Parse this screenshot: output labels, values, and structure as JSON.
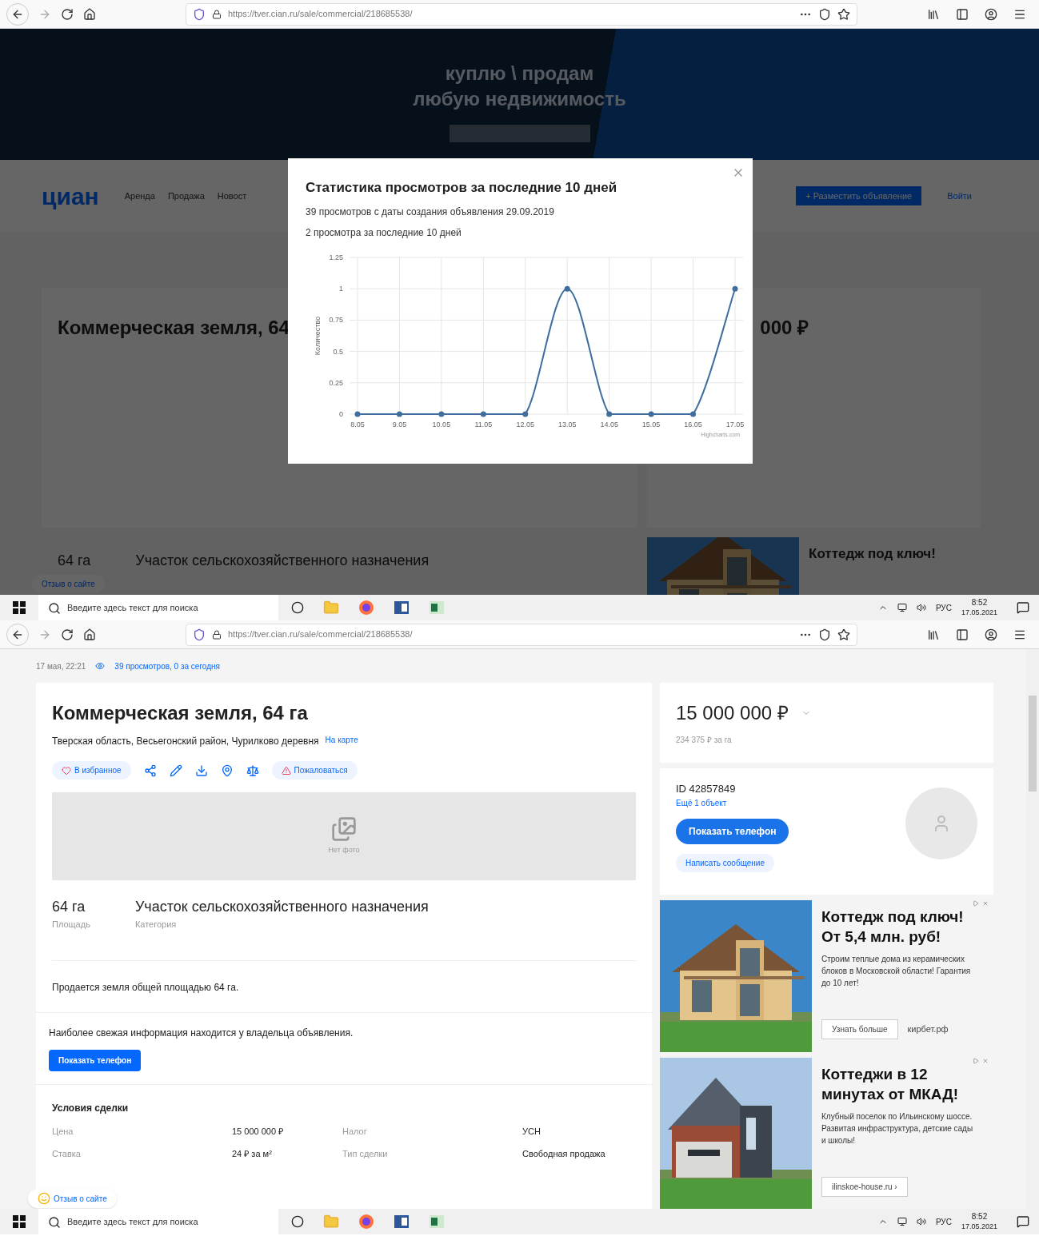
{
  "top_screen": {
    "browser": {
      "url": "https://tver.cian.ru/sale/commercial/218685538/"
    },
    "banner": {
      "headline": [
        "куплю \\ продам",
        "любую недвижимость"
      ]
    },
    "header": {
      "logo": "циан",
      "nav": [
        "Аренда",
        "Продажа",
        "Новост"
      ],
      "post_button": "+ Разместить объявление",
      "login": "Войти"
    },
    "listing": {
      "title": "Коммерческая земля, 64",
      "price": "000 ₽",
      "area": "64 га",
      "category": "Участок сельскохозяйственного назначения",
      "ad_title": "Коттедж под ключ!"
    },
    "feedback": "Отзыв о сайте",
    "modal": {
      "title": "Статистика просмотров за последние 10 дней",
      "lines": [
        "39 просмотров с даты создания объявления 29.09.2019",
        "2 просмотра за последние 10 дней"
      ],
      "chart_data": {
        "type": "line",
        "ylabel": "Количество",
        "categories": [
          "8.05",
          "9.05",
          "10.05",
          "11.05",
          "12.05",
          "13.05",
          "14.05",
          "15.05",
          "16.05",
          "17.05"
        ],
        "values": [
          0,
          0,
          0,
          0,
          0,
          1,
          0,
          0,
          0,
          1
        ],
        "ylim": [
          0,
          1.25
        ],
        "grid": true,
        "marker": true,
        "yticks": [
          0,
          0.25,
          0.5,
          0.75,
          1,
          1.25
        ]
      },
      "credit": "Highcharts.com"
    },
    "taskbar": {
      "search_placeholder": "Введите здесь текст для поиска",
      "language": "РУС",
      "time": "8:52",
      "date": "17.05.2021"
    }
  },
  "bottom_screen": {
    "browser": {
      "url": "https://tver.cian.ru/sale/commercial/218685538/"
    },
    "meta": {
      "date": "17 мая, 22:21",
      "views": "39 просмотров, 0 за сегодня"
    },
    "listing": {
      "title": "Коммерческая земля, 64 га",
      "address": "Тверская область, Весьегонский район, Чурилково деревня",
      "map_link": "На карте",
      "favorite": "В избранное",
      "report": "Пожаловаться",
      "no_photo": "Нет фото",
      "facts": [
        {
          "value": "64 га",
          "label": "Площадь"
        },
        {
          "value": "Участок сельскохозяйственного назначения",
          "label": "Категория"
        }
      ],
      "description": "Продается земля общей площадью 64 га.",
      "owner_note": "Наиболее свежая информация находится у владельца объявления.",
      "show_phone": "Показать телефон",
      "deal": {
        "heading": "Условия сделки",
        "rows": [
          {
            "label": "Цена",
            "value": "15 000 000 ₽",
            "label_2": "Налог",
            "value_2": "УСН"
          },
          {
            "label": "Ставка",
            "value": "24 ₽ за м²",
            "label_2": "Тип сделки",
            "value_2": "Свободная продажа"
          }
        ]
      }
    },
    "price": {
      "amount": "15 000 000 ₽",
      "per_unit": "234 375 ₽ за га"
    },
    "seller": {
      "id": "ID 42857849",
      "more": "Ещё 1 объект",
      "show_phone": "Показать телефон",
      "message": "Написать сообщение"
    },
    "ads": [
      {
        "title": "Коттедж под ключ! От 5,4 млн. руб!",
        "text": "Строим теплые дома из керамических блоков в Московской области! Гарантия до 10 лет!",
        "button": "Узнать больше",
        "domain": "кирбет.рф"
      },
      {
        "title": "Коттеджи в 12 минутах от МКАД!",
        "text": "Клубный поселок по Ильинскому шоссе. Развитая инфраструктура, детские сады и школы!",
        "button": "ilinskoe-house.ru ›"
      }
    ],
    "feedback": "Отзыв о сайте",
    "taskbar": {
      "search_placeholder": "Введите здесь текст для поиска",
      "language": "РУС",
      "time": "8:52",
      "date": "17.05.2021"
    }
  }
}
